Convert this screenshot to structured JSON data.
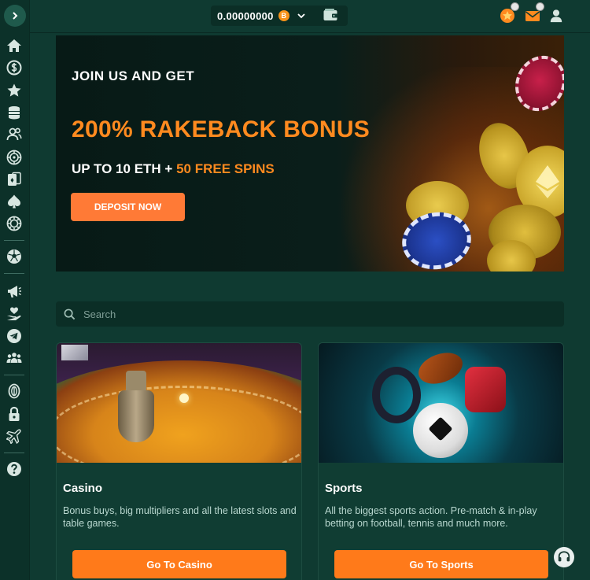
{
  "header": {
    "balance": "0.00000000",
    "currency_symbol": "B",
    "currency_icon": "bitcoin-icon"
  },
  "sidebar": {
    "items": [
      {
        "name": "home",
        "icon": "home-icon"
      },
      {
        "name": "dollar",
        "icon": "dollar-coin-icon"
      },
      {
        "name": "favorites",
        "icon": "star-icon"
      },
      {
        "name": "coins",
        "icon": "coin-stack-icon"
      },
      {
        "name": "users",
        "icon": "users-icon"
      },
      {
        "name": "roulette",
        "icon": "roulette-icon"
      },
      {
        "name": "cards",
        "icon": "playing-cards-icon"
      },
      {
        "name": "poker",
        "icon": "spade-icon"
      },
      {
        "name": "live",
        "icon": "chip-icon"
      },
      {
        "name": "sports",
        "icon": "soccer-ball-icon"
      },
      {
        "name": "promotions",
        "icon": "megaphone-icon"
      },
      {
        "name": "charity",
        "icon": "heart-hand-icon"
      },
      {
        "name": "telegram",
        "icon": "telegram-icon"
      },
      {
        "name": "community",
        "icon": "group-icon"
      },
      {
        "name": "token",
        "icon": "token-icon"
      },
      {
        "name": "security",
        "icon": "lock-icon"
      },
      {
        "name": "travel",
        "icon": "airplane-icon"
      },
      {
        "name": "help",
        "icon": "help-icon"
      }
    ]
  },
  "hero": {
    "kicker": "JOIN US AND GET",
    "title": "200% RAKEBACK BONUS",
    "sub_prefix": "UP TO 10 ETH + ",
    "sub_highlight": "50 FREE SPINS",
    "cta": "DEPOSIT NOW"
  },
  "search": {
    "placeholder": "Search"
  },
  "cards": [
    {
      "title": "Casino",
      "description": "Bonus buys, big multipliers and all the latest slots and table games.",
      "button": "Go To Casino"
    },
    {
      "title": "Sports",
      "description": "All the biggest sports action. Pre-match & in-play betting on football, tennis and much more.",
      "button": "Go To Sports"
    }
  ],
  "colors": {
    "accent": "#ff7a1a",
    "background": "#0f3a31",
    "hero_title": "#ff8a1f"
  }
}
